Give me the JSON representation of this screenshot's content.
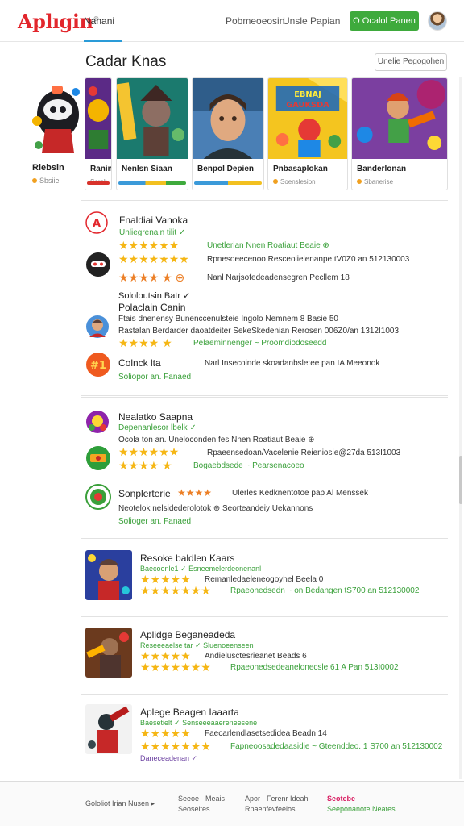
{
  "header": {
    "logo": "Aplıgin",
    "logo_mark": "®",
    "nav_active": "Nanani",
    "nav_links": [
      "Pobmeoeosin",
      "Unsle Papian"
    ],
    "cta": "O Ocalol Panen"
  },
  "featured": {
    "title": "Cadar Knas",
    "button": "Unelie Pegogohen",
    "hero_label": "Rlebsin",
    "hero_meta": "Sbsiie",
    "cards": [
      {
        "title": "Ranin",
        "meta": "Seroh",
        "bar_color": "#d8322b"
      },
      {
        "title": "Nenlsn Siaan",
        "meta": "",
        "bar_color": "#3b9ad9"
      },
      {
        "title": "Benpol Depien",
        "meta": "",
        "bar_color": "#f2c020"
      },
      {
        "title": "Pnbasaplokan",
        "meta": "Soenslesion",
        "bar_color": ""
      },
      {
        "title": "Banderlonan",
        "meta": "Sbanerise",
        "bar_color": ""
      }
    ],
    "card_art_text": "EBNAJ GAUKSDA"
  },
  "list1": {
    "items": [
      {
        "title": "Fnaldiai Vanoka",
        "sub": "Unliegrenain tilit ✓"
      },
      {
        "title": "",
        "line1": "Unetlerian Nnen Roatiaut Beaie ⊕",
        "line2": "Rpnesoeecenoo Resceolielenanpe tV0Z0 an 512130003",
        "line3": "Nanl Narjsofedeadensegren Pecllem 18"
      },
      {
        "title": "Sololoutsin Batr ✓",
        "title2": "Polaclain Canin"
      },
      {
        "title": "",
        "line1": "Ftais dnenensy Bunenccenulsteie Ingolo Nemnem 8 Basie 50",
        "line2": "Rastalan Berdarder daoatdeiter SekeSkedenian Rerosen 006Z0/an 1312I1003",
        "line3": "Pelaeminnenger ~ Proomdiodoseedd"
      },
      {
        "title": "Colnck lta",
        "line1": "Narl Insecoinde skoadanbsletee pan IA Meeonok",
        "sub": "Soliopor an. Fanaed"
      }
    ]
  },
  "list2": {
    "items": [
      {
        "title": "Nealatko Saapna",
        "sub": "Depenanlesor lbelk ✓"
      },
      {
        "line1": "Ocola ton an. Uneloconden fes Nnen Roatiaut Beaie ⊕",
        "line2": "Rpaeensedoan/Vacelenie Reieniosie@27da 513I1003",
        "line3": "Bogaebdsede ~ Pearsenacoeo"
      },
      {
        "title": "Sonplerterie",
        "line1": "Ulerles Kedknentotoe pap Al Menssek",
        "line2": "Neotelok nelsidederolotok ⊕ Seorteandeiy Uekannons",
        "sub": "Solioger an. Fanaed"
      }
    ]
  },
  "list3": {
    "items": [
      {
        "title": "Resoke baldlen Kaars",
        "sub": "Baecoenle1 ✓ Esneemelerdeonenanl",
        "line1": "Remanledaeleneogoyhel Beela 0",
        "line2": "Rpaeonedsedn ~ on Bedangen tS700 an 512130002"
      },
      {
        "title": "Aplidge Beganeadeda",
        "sub": "Reseeeaelse tar ✓ Sluenoeenseen",
        "line1": "Andielusctesrieanet Beads 6",
        "line2": "Rpaeonedsedeanelonecsle 61 A Pan 513I0002"
      },
      {
        "title": "Aplege Beagen Iaaarta",
        "sub": "Baesetielt ✓ Senseeeaaereneesene",
        "line1": "Faecarlendlasetsedidea Beadn 14",
        "line2": "Fapneoosadedaasidie ~ Gteenddeo. 1 S700 an 512130002",
        "sub2": "Daneceadenan ✓"
      }
    ]
  },
  "footer": {
    "col1": "Gololiot Irian Nusen ▸",
    "col2a": "Seeoe · Meais",
    "col2b": "Seoseites",
    "col3a": "Apor · Ferenr Ideah",
    "col3b": "Rpaenfevfeelos",
    "col4a": "Seotebe",
    "col4b": "Seeponanote Neates"
  },
  "colors": {
    "brand": "#e2262c",
    "accent_green": "#3eaa3c",
    "star": "#f5b614",
    "tab_underline": "#2a9bd8"
  }
}
